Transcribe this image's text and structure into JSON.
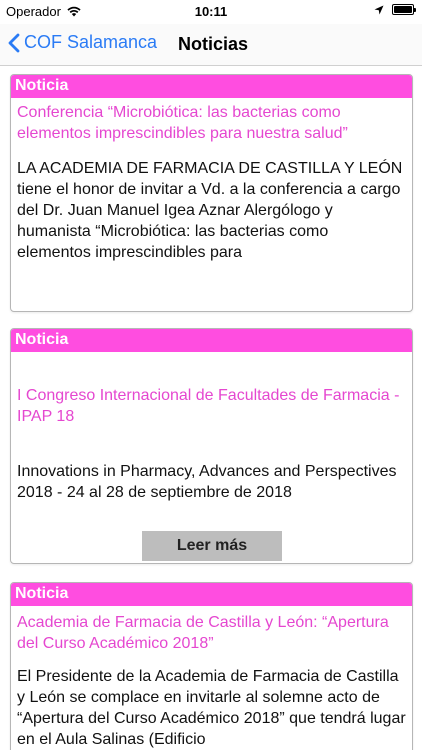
{
  "status_bar": {
    "carrier": "Operador",
    "time": "10:11"
  },
  "nav": {
    "back_label": "COF Salamanca",
    "title": "Noticias"
  },
  "colors": {
    "accent_blue": "#2a7bf5",
    "header_pink": "#ff4de0",
    "title_pink": "#e547d0"
  },
  "news": [
    {
      "header": "Noticia",
      "title": "Conferencia “Microbiótica: las bacterias como elementos imprescindibles para nuestra salud”",
      "body": "LA ACADEMIA DE FARMACIA DE CASTILLA Y LEÓN tiene el honor de invitar a Vd. a la conferencia a cargo del Dr. Juan Manuel Igea Aznar Alergólogo y humanista “Microbiótica: las bacterias como elementos imprescindibles para"
    },
    {
      "header": "Noticia",
      "title": "I Congreso Internacional de Facultades de Farmacia - IPAP 18",
      "body": "Innovations in Pharmacy, Advances and Perspectives 2018 - 24 al 28 de septiembre de 2018",
      "read_more": "Leer más"
    },
    {
      "header": "Noticia",
      "title": "Academia de Farmacia de Castilla y León: “Apertura del Curso Académico 2018”",
      "body": "El Presidente de la Academia de Farmacia de Castilla y León se complace en invitarle al solemne acto de “Apertura del Curso Académico 2018” que tendrá lugar en el Aula Salinas (Edificio"
    }
  ]
}
